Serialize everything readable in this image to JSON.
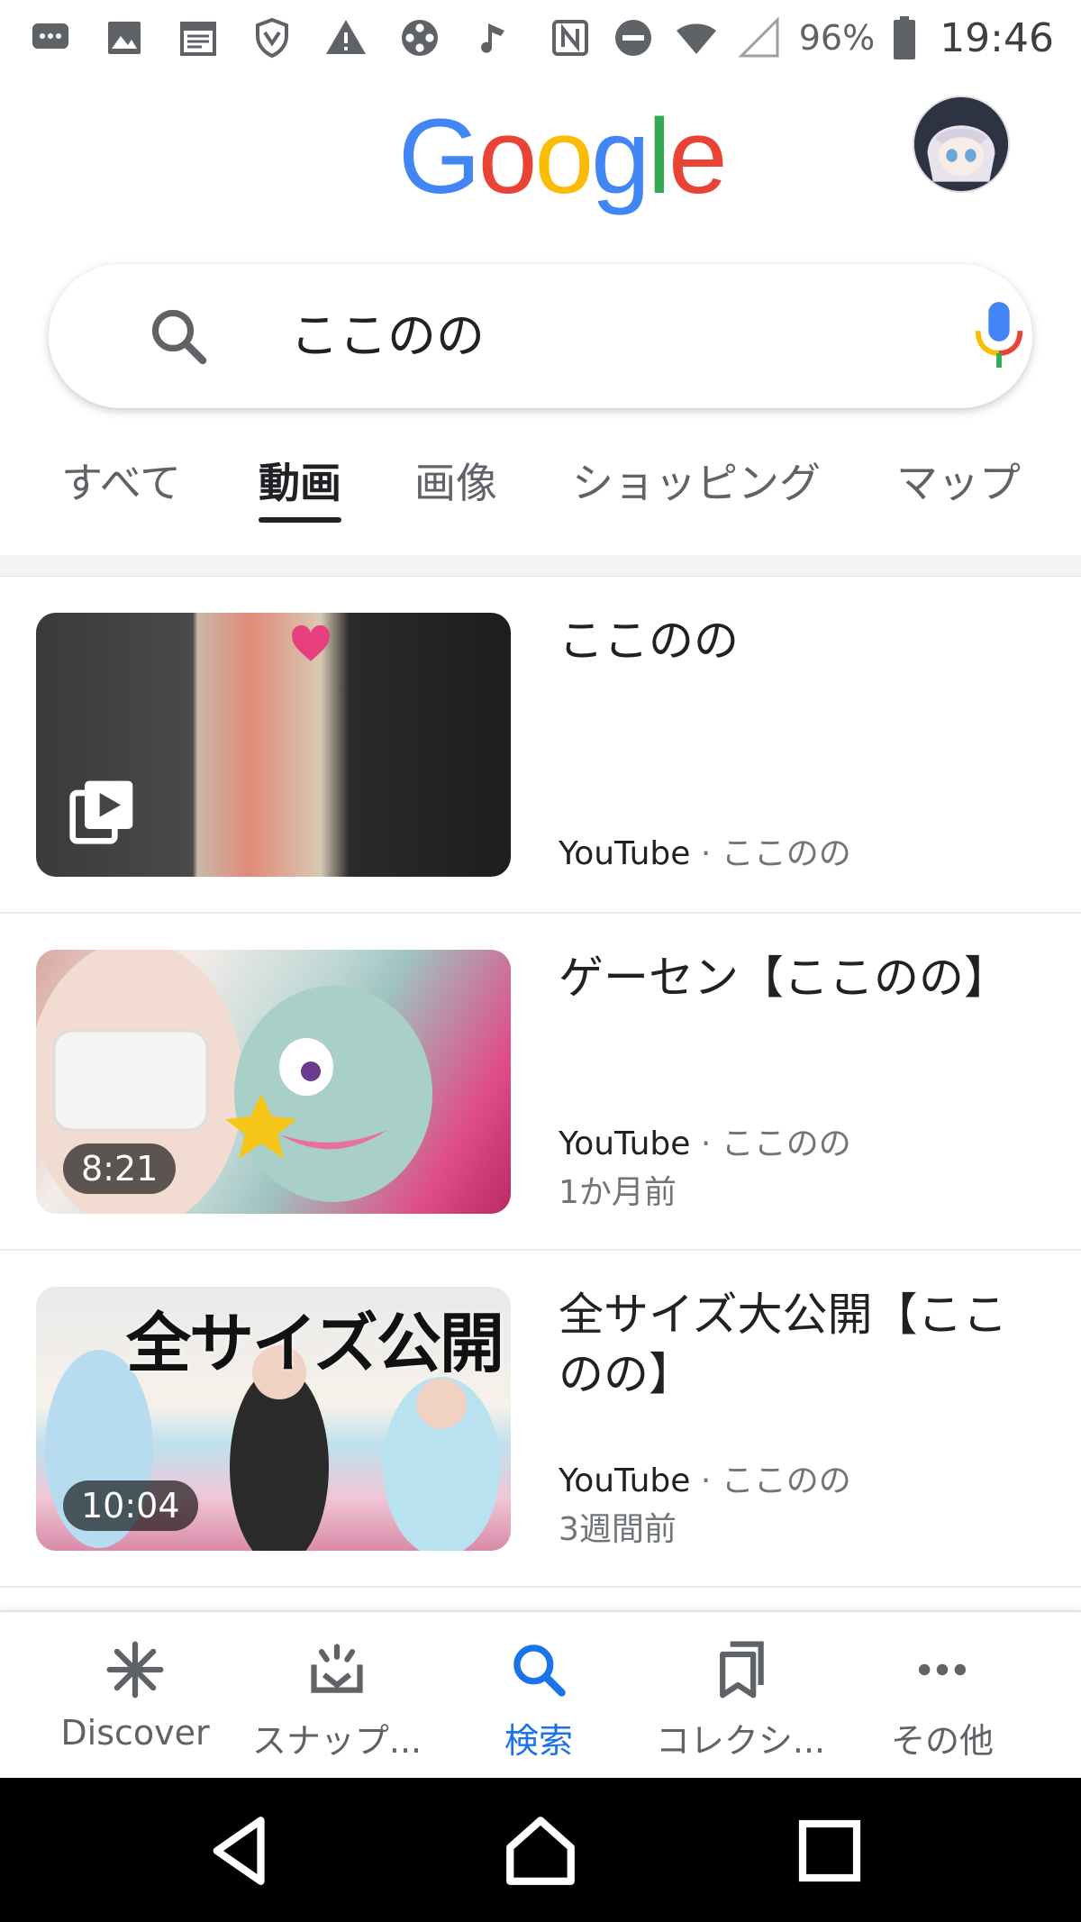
{
  "status_bar": {
    "battery_percent": "96%",
    "time": "19:46",
    "left_icons": [
      "message-icon",
      "image-icon",
      "calendar-icon",
      "shield-icon",
      "warning-icon",
      "film-reel-icon",
      "music-note-icon"
    ],
    "right_icons": [
      "nfc-icon",
      "do-not-disturb-icon",
      "wifi-icon",
      "cell-signal-icon",
      "battery-icon"
    ]
  },
  "header": {
    "logo_letters": [
      "G",
      "o",
      "o",
      "g",
      "l",
      "e"
    ]
  },
  "search": {
    "query": "ここのの"
  },
  "tabs": [
    {
      "label": "すべて",
      "active": false
    },
    {
      "label": "動画",
      "active": true
    },
    {
      "label": "画像",
      "active": false
    },
    {
      "label": "ショッピング",
      "active": false
    },
    {
      "label": "マップ",
      "active": false
    }
  ],
  "results": [
    {
      "title": "ここのの",
      "source": "YouTube",
      "separator": "·",
      "channel": "ここのの",
      "age": "",
      "duration": "",
      "playlist": true
    },
    {
      "title": "ゲーセン【ここのの】",
      "source": "YouTube",
      "separator": "·",
      "channel": "ここのの",
      "age": "1か月前",
      "duration": "8:21",
      "playlist": false
    },
    {
      "title": "全サイズ大公開【ここのの】",
      "source": "YouTube",
      "separator": "·",
      "channel": "ここのの",
      "age": "3週間前",
      "duration": "10:04",
      "playlist": false,
      "thumbnail_text": "全サイズ公開"
    }
  ],
  "bottom_nav": [
    {
      "label": "Discover",
      "icon": "asterisk-icon",
      "active": false
    },
    {
      "label": "スナップ...",
      "icon": "snapshot-icon",
      "active": false
    },
    {
      "label": "検索",
      "icon": "search-icon",
      "active": true
    },
    {
      "label": "コレクシ...",
      "icon": "collections-icon",
      "active": false
    },
    {
      "label": "その他",
      "icon": "more-icon",
      "active": false
    }
  ],
  "colors": {
    "accent": "#1a73e8",
    "google_blue": "#4285f4",
    "google_red": "#ea4335",
    "google_yellow": "#fbbc05",
    "google_green": "#34a853"
  }
}
